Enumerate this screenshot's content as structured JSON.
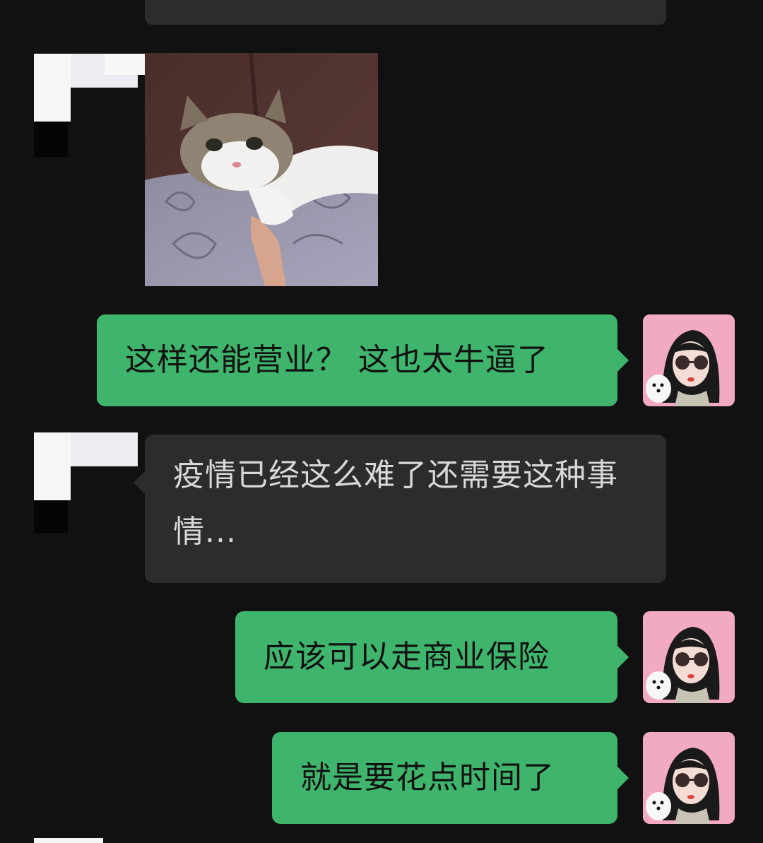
{
  "chat": {
    "messages": [
      {
        "side": "left",
        "type": "image",
        "alt": ""
      },
      {
        "side": "right",
        "type": "text",
        "text": "这样还能营业？ 这也太牛逼了"
      },
      {
        "side": "left",
        "type": "text",
        "text": "疫情已经这么难了还需要这种事情..."
      },
      {
        "side": "right",
        "type": "text",
        "text": "应该可以走商业保险"
      },
      {
        "side": "right",
        "type": "text",
        "text": "就是要花点时间了"
      }
    ]
  },
  "icons": {
    "left_avatar": "pixelated-avatar-icon",
    "right_avatar": "cartoon-girl-sunglasses-avatar-icon"
  },
  "colors": {
    "background": "#111111",
    "bubble_right": "#3eb46c",
    "bubble_left": "#2c2c2c",
    "text_left": "#d8d8d8",
    "text_right": "#111111",
    "avatar_right_bg": "#f2a9c4"
  }
}
